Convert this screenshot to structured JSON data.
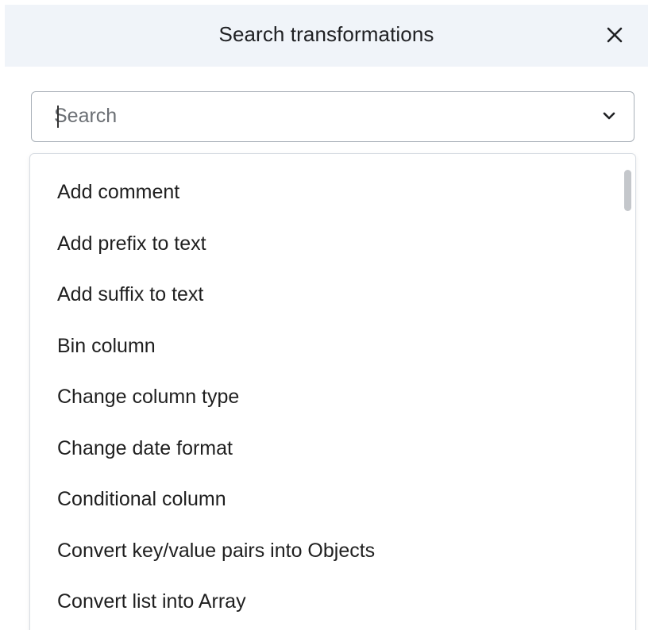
{
  "dialog": {
    "title": "Search transformations",
    "close_icon": "close-icon"
  },
  "search": {
    "value": "",
    "placeholder": "Search",
    "dropdown_icon": "chevron-down-icon"
  },
  "options": [
    "Add comment",
    "Add prefix to text",
    "Add suffix to text",
    "Bin column",
    "Change column type",
    "Change date format",
    "Conditional column",
    "Convert key/value pairs into Objects",
    "Convert list into Array"
  ],
  "colors": {
    "header_background": "#f0f4f9",
    "input_border": "#a9b0b8",
    "dropdown_border": "#d8dde3",
    "scrollbar_thumb": "#c4c7cb"
  }
}
